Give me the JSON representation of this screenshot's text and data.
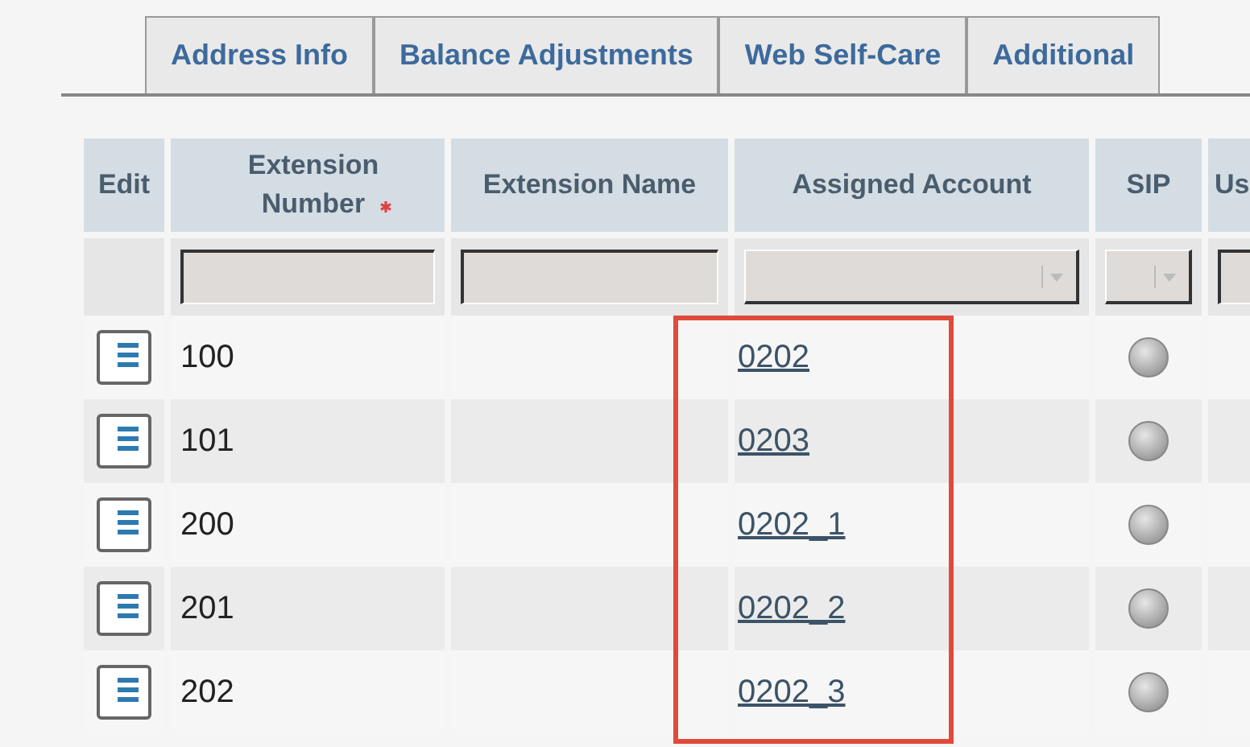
{
  "tabs": [
    {
      "label": "Address Info",
      "selected": false
    },
    {
      "label": "Balance Adjustments",
      "selected": false
    },
    {
      "label": "Web Self-Care",
      "selected": false
    },
    {
      "label": "Additional",
      "selected": false
    }
  ],
  "table": {
    "columns": [
      {
        "label": "Edit"
      },
      {
        "label": "Extension Number",
        "required": true
      },
      {
        "label": "Extension Name"
      },
      {
        "label": "Assigned Account"
      },
      {
        "label": "SIP"
      },
      {
        "label": "Us"
      }
    ],
    "filters": [
      {
        "kind": "none"
      },
      {
        "kind": "text"
      },
      {
        "kind": "text"
      },
      {
        "kind": "select"
      },
      {
        "kind": "select"
      },
      {
        "kind": "text"
      }
    ],
    "rows": [
      {
        "extension_number": "100",
        "assigned_account": "0202"
      },
      {
        "extension_number": "101",
        "assigned_account": "0203"
      },
      {
        "extension_number": "200",
        "assigned_account": "0202_1"
      },
      {
        "extension_number": "201",
        "assigned_account": "0202_2"
      },
      {
        "extension_number": "202",
        "assigned_account": "0202_3"
      }
    ]
  }
}
